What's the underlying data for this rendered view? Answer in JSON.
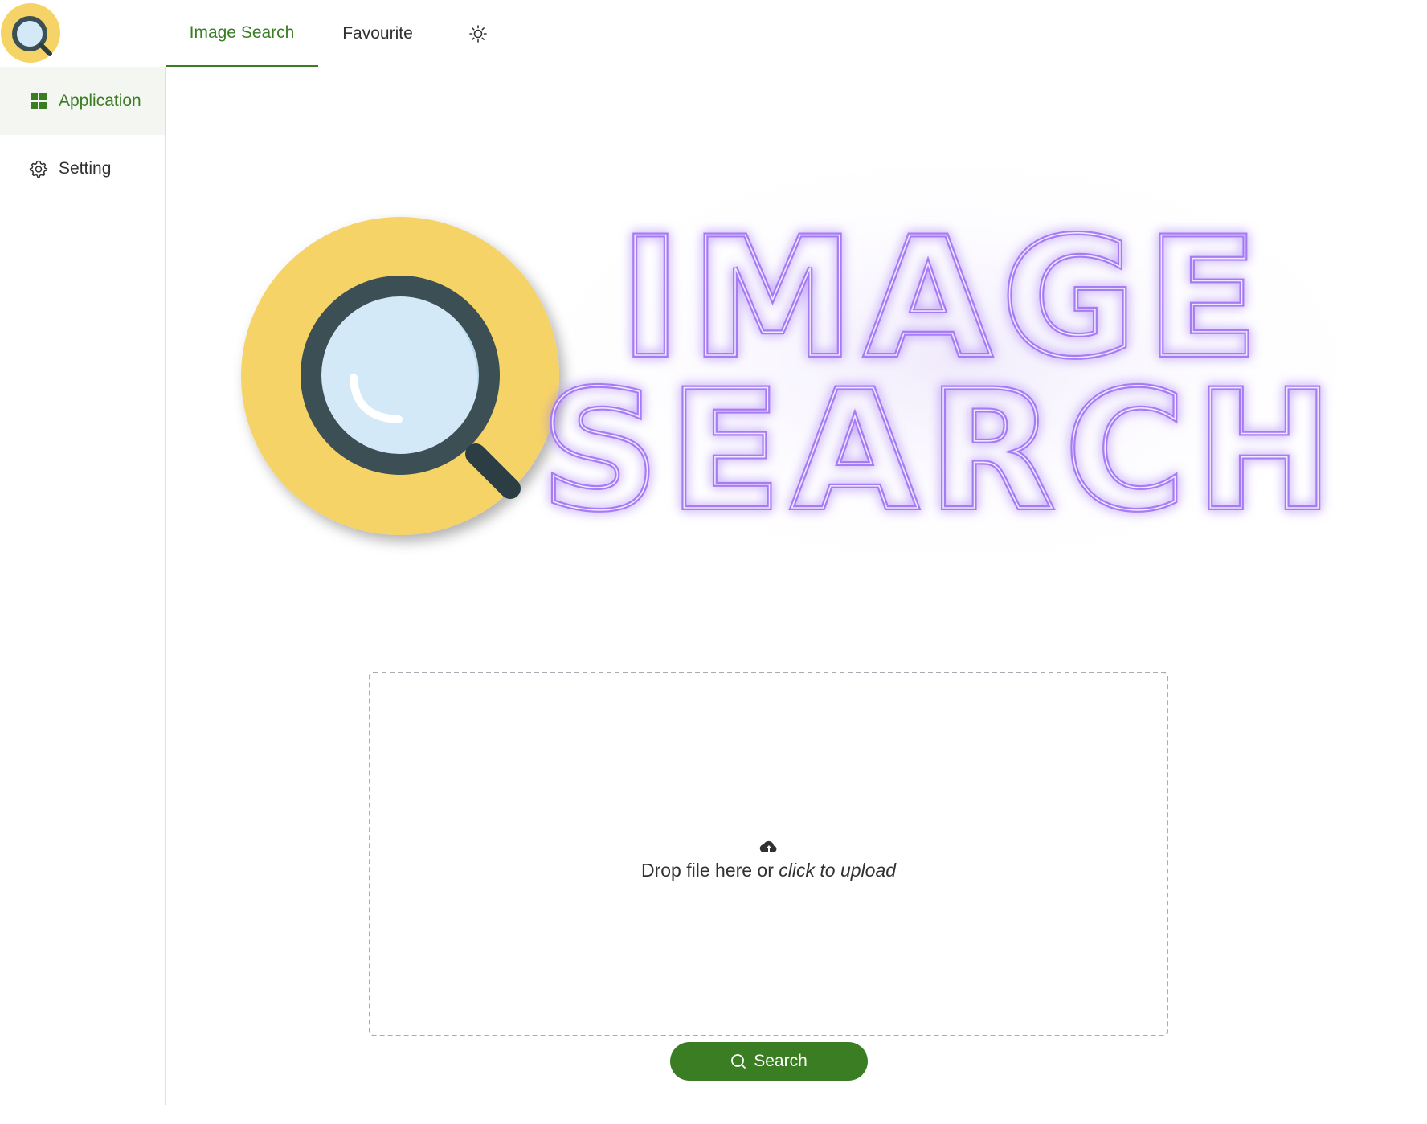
{
  "header": {
    "tabs": [
      {
        "label": "Image Search",
        "active": true
      },
      {
        "label": "Favourite",
        "active": false
      }
    ],
    "theme_toggle_icon": "sun-icon",
    "logo_icon": "magnifier-logo"
  },
  "sidebar": {
    "items": [
      {
        "label": "Application",
        "icon": "grid-icon",
        "active": true
      },
      {
        "label": "Setting",
        "icon": "gear-icon",
        "active": false
      }
    ]
  },
  "banner": {
    "line1": "IMAGE",
    "line2": "SEARCH"
  },
  "upload": {
    "icon": "cloud-upload-icon",
    "text_prefix": "Drop file here or ",
    "text_link": "click to upload"
  },
  "search_button": {
    "label": "Search",
    "icon": "search-icon"
  },
  "colors": {
    "accent": "#3a7d23",
    "logo_yellow": "#f6d366",
    "lens_dark": "#3b4f55",
    "lens_glass": "#d4e9f7",
    "neon_purple": "#a67cf5"
  }
}
